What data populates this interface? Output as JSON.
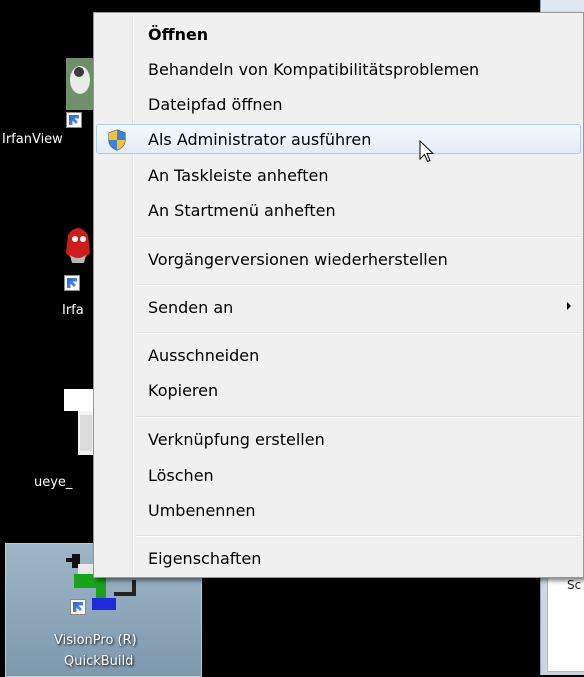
{
  "desktop": {
    "icons": [
      {
        "label": "IrfanView"
      },
      {
        "label": "Irfa"
      },
      {
        "label": "ueye_"
      },
      {
        "label_line1": "VisionPro (R)",
        "label_line2": "QuickBuild"
      }
    ],
    "partial_window_text": "Sc"
  },
  "context_menu": {
    "items": [
      {
        "label": "Öffnen"
      },
      {
        "label": "Behandeln von Kompatibilitätsproblemen"
      },
      {
        "label": "Dateipfad öffnen"
      },
      {
        "label": "Als Administrator ausführen",
        "icon": "uac-shield-icon"
      },
      {
        "label": "An Taskleiste anheften"
      },
      {
        "label": "An Startmenü anheften"
      },
      {
        "label": "Vorgängerversionen wiederherstellen"
      },
      {
        "label": "Senden an"
      },
      {
        "label": "Ausschneiden"
      },
      {
        "label": "Kopieren"
      },
      {
        "label": "Verknüpfung erstellen"
      },
      {
        "label": "Löschen"
      },
      {
        "label": "Umbenennen"
      },
      {
        "label": "Eigenschaften"
      }
    ]
  },
  "colors": {
    "menu_bg": "#f0f0f0",
    "hover_border": "#aeccf0",
    "desktop_bg": "#000000"
  }
}
